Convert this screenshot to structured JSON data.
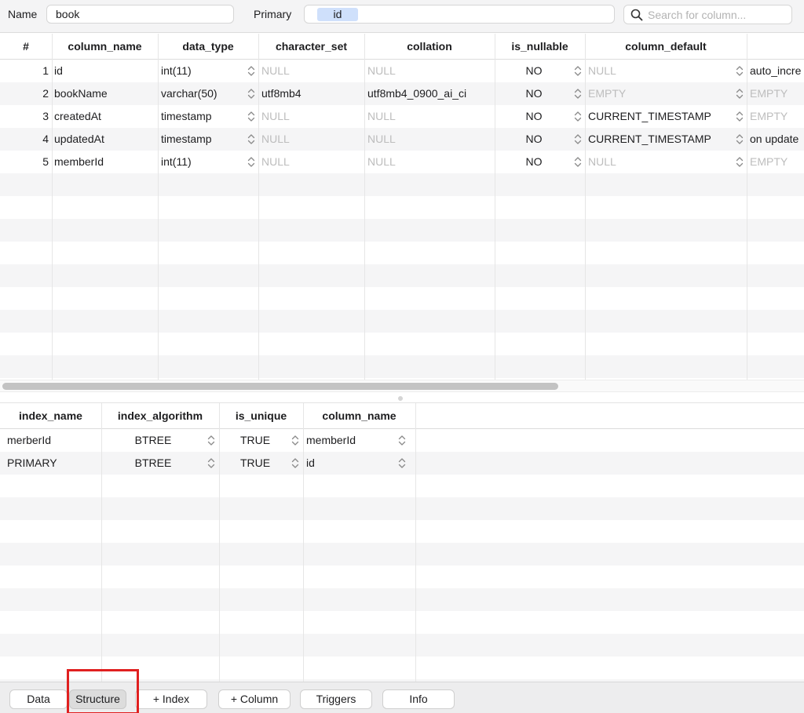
{
  "top": {
    "name_label": "Name",
    "name_value": "book",
    "primary_label": "Primary",
    "primary_value": "id",
    "search_placeholder": "Search for column..."
  },
  "columns_table": {
    "headers": [
      "#",
      "column_name",
      "data_type",
      "character_set",
      "collation",
      "is_nullable",
      "column_default"
    ],
    "rows": [
      {
        "num": "1",
        "name": "id",
        "type": "int(11)",
        "charset": "NULL",
        "collation": "NULL",
        "nullable": "NO",
        "default": "NULL",
        "extra": "auto_incre"
      },
      {
        "num": "2",
        "name": "bookName",
        "type": "varchar(50)",
        "charset": "utf8mb4",
        "collation": "utf8mb4_0900_ai_ci",
        "nullable": "NO",
        "default": "EMPTY",
        "extra": "EMPTY"
      },
      {
        "num": "3",
        "name": "createdAt",
        "type": "timestamp",
        "charset": "NULL",
        "collation": "NULL",
        "nullable": "NO",
        "default": "CURRENT_TIMESTAMP",
        "extra": "EMPTY"
      },
      {
        "num": "4",
        "name": "updatedAt",
        "type": "timestamp",
        "charset": "NULL",
        "collation": "NULL",
        "nullable": "NO",
        "default": "CURRENT_TIMESTAMP",
        "extra": "on update"
      },
      {
        "num": "5",
        "name": "memberId",
        "type": "int(11)",
        "charset": "NULL",
        "collation": "NULL",
        "nullable": "NO",
        "default": "NULL",
        "extra": "EMPTY"
      }
    ]
  },
  "index_table": {
    "headers": [
      "index_name",
      "index_algorithm",
      "is_unique",
      "column_name"
    ],
    "rows": [
      {
        "name": "merberId",
        "algorithm": "BTREE",
        "unique": "TRUE",
        "column": "memberId"
      },
      {
        "name": "PRIMARY",
        "algorithm": "BTREE",
        "unique": "TRUE",
        "column": "id"
      }
    ]
  },
  "bottom_bar": {
    "data": "Data",
    "structure": "Structure",
    "index": "+  Index",
    "column": "+ Column",
    "triggers": "Triggers",
    "info": "Info",
    "selected": "structure"
  },
  "colors": {
    "muted_text": "#bdbdbd",
    "primary_chip": "#cfe0fb",
    "highlight_box": "#e02020"
  }
}
